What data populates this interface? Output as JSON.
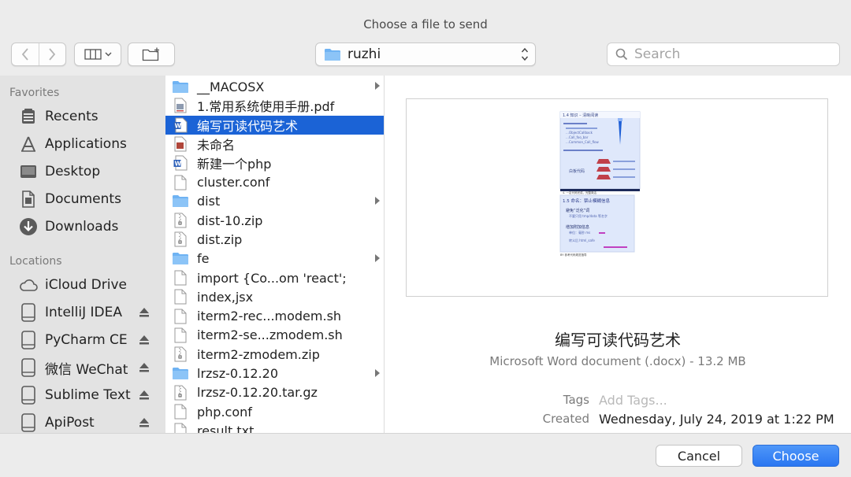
{
  "window": {
    "title": "Choose a file to send"
  },
  "toolbar": {
    "location": "ruzhi",
    "search_placeholder": "Search"
  },
  "sidebar": {
    "favorites_title": "Favorites",
    "favorites": [
      {
        "label": "Recents",
        "icon": "recents-icon"
      },
      {
        "label": "Applications",
        "icon": "applications-icon"
      },
      {
        "label": "Desktop",
        "icon": "desktop-icon"
      },
      {
        "label": "Documents",
        "icon": "documents-icon"
      },
      {
        "label": "Downloads",
        "icon": "downloads-icon"
      }
    ],
    "locations_title": "Locations",
    "locations": [
      {
        "label": "iCloud Drive",
        "icon": "cloud-icon",
        "eject": false
      },
      {
        "label": "IntelliJ IDEA",
        "icon": "disk-icon",
        "eject": true
      },
      {
        "label": "PyCharm CE",
        "icon": "disk-icon",
        "eject": true
      },
      {
        "label": "微信 WeChat",
        "icon": "disk-icon",
        "eject": true
      },
      {
        "label": "Sublime Text",
        "icon": "disk-icon",
        "eject": true
      },
      {
        "label": "ApiPost",
        "icon": "disk-icon",
        "eject": true
      }
    ]
  },
  "files": [
    {
      "name": "__MACOSX",
      "type": "folder",
      "arrow": true
    },
    {
      "name": "1.常用系统使用手册.pdf",
      "type": "pdf"
    },
    {
      "name": "编写可读代码艺术",
      "type": "word",
      "selected": true
    },
    {
      "name": "未命名",
      "type": "doc-image"
    },
    {
      "name": "新建一个php",
      "type": "word"
    },
    {
      "name": "cluster.conf",
      "type": "doc"
    },
    {
      "name": "dist",
      "type": "folder",
      "arrow": true
    },
    {
      "name": "dist-10.zip",
      "type": "zip"
    },
    {
      "name": "dist.zip",
      "type": "zip"
    },
    {
      "name": "fe",
      "type": "folder",
      "arrow": true
    },
    {
      "name": "import {Co...om 'react';",
      "type": "doc"
    },
    {
      "name": "index,jsx",
      "type": "doc"
    },
    {
      "name": "iterm2-rec...modem.sh",
      "type": "doc"
    },
    {
      "name": "iterm2-se...zmodem.sh",
      "type": "doc"
    },
    {
      "name": "iterm2-zmodem.zip",
      "type": "zip"
    },
    {
      "name": "lrzsz-0.12.20",
      "type": "folder",
      "arrow": true
    },
    {
      "name": "lrzsz-0.12.20.tar.gz",
      "type": "zip"
    },
    {
      "name": "php.conf",
      "type": "doc"
    },
    {
      "name": "result.txt",
      "type": "doc"
    }
  ],
  "preview": {
    "name": "编写可读代码艺术",
    "kind": "Microsoft Word document (.docx) - 13.2 MB",
    "tags_label": "Tags",
    "tags_placeholder": "Add Tags...",
    "created_label": "Created",
    "created_value": "Wednesday, July 24, 2019 at 1:22 PM",
    "thumbnail": {
      "slide1": {
        "header": "1.4 知识 – 清晰阅读",
        "label": "白板代码",
        "lines": [
          "…ObjectCallback",
          "…Call_foo_bar",
          "…Common_Call_flow"
        ],
        "footer": "4. 一定代码完成，完整简洁"
      },
      "slide2": {
        "header": "1.5 命名：禁止模糊信息",
        "title1": "避免“泛化”词",
        "line1": "不要只用 tmp/data 等名字",
        "title2": "增加附加信息",
        "line2": "单位：毫秒 ms",
        "line3": "转义后 html_safe",
        "footer": "BY 参考代码规范指导"
      }
    }
  },
  "buttons": {
    "cancel": "Cancel",
    "choose": "Choose"
  },
  "colors": {
    "accent": "#1b63d6",
    "folder": "#6fb3f3",
    "choose_button": "#2a76f1"
  }
}
